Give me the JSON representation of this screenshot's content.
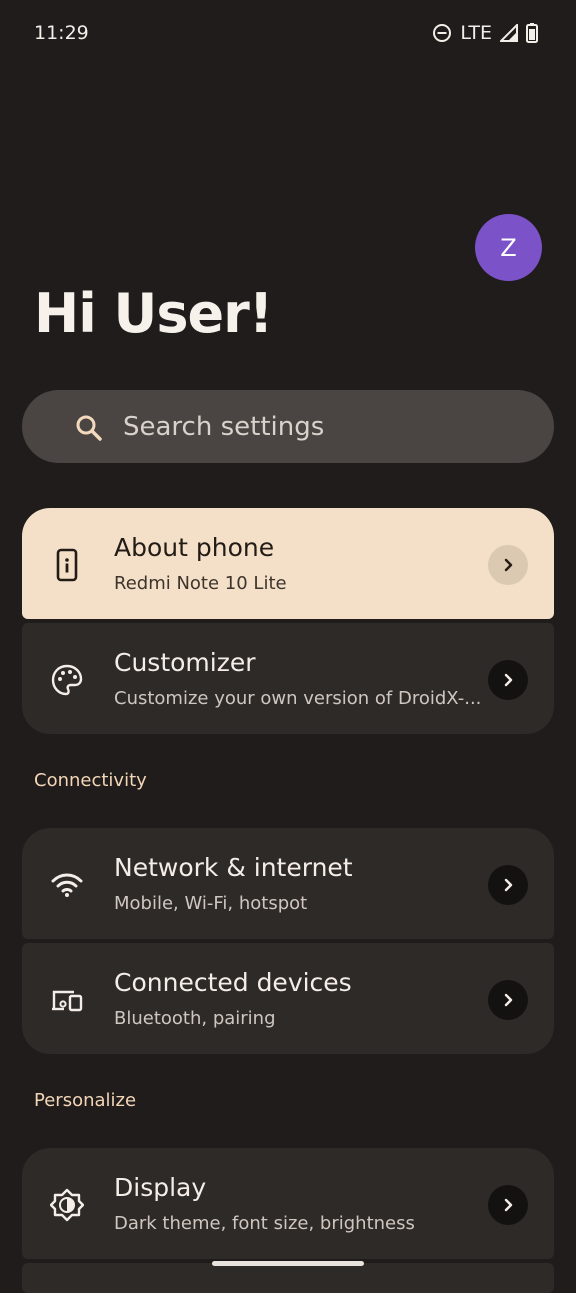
{
  "status": {
    "time": "11:29",
    "network": "LTE"
  },
  "header": {
    "greeting": "Hi User!",
    "avatar_initial": "Z"
  },
  "search": {
    "placeholder": "Search settings"
  },
  "cards": [
    {
      "title": "About phone",
      "subtitle": "Redmi Note 10 Lite",
      "icon": "phone-info-icon"
    },
    {
      "title": "Customizer",
      "subtitle": "Customize your own version of DroidX-...",
      "icon": "palette-icon"
    }
  ],
  "sections": {
    "connectivity": {
      "label": "Connectivity",
      "items": [
        {
          "title": "Network & internet",
          "subtitle": "Mobile, Wi-Fi, hotspot",
          "icon": "wifi-icon"
        },
        {
          "title": "Connected devices",
          "subtitle": "Bluetooth, pairing",
          "icon": "devices-icon"
        }
      ]
    },
    "personalize": {
      "label": "Personalize",
      "items": [
        {
          "title": "Display",
          "subtitle": "Dark theme, font size, brightness",
          "icon": "display-brightness-icon"
        }
      ]
    }
  },
  "colors": {
    "background": "#1f1c1b",
    "highlight_card": "#f4e0c8",
    "avatar": "#7b52c7",
    "section_label": "#f2d6b7"
  }
}
